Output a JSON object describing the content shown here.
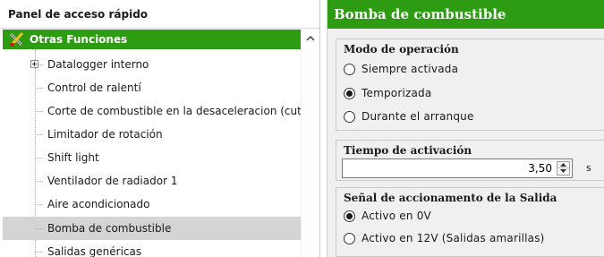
{
  "left_panel": {
    "header": "Panel de acceso rápido",
    "group": {
      "label": "Otras Funciones",
      "icon": "tools-icon"
    },
    "items": [
      {
        "label": "Datalogger interno",
        "expandable": true,
        "selected": false
      },
      {
        "label": "Control de ralentí",
        "expandable": false,
        "selected": false
      },
      {
        "label": "Corte de combustible en la desaceleracion (cutoff)",
        "expandable": false,
        "selected": false
      },
      {
        "label": "Limitador de rotación",
        "expandable": false,
        "selected": false
      },
      {
        "label": "Shift light",
        "expandable": false,
        "selected": false
      },
      {
        "label": "Ventilador de radiador 1",
        "expandable": false,
        "selected": false
      },
      {
        "label": "Aire acondicionado",
        "expandable": false,
        "selected": false
      },
      {
        "label": "Bomba de combustible",
        "expandable": false,
        "selected": true
      },
      {
        "label": "Salidas genéricas",
        "expandable": false,
        "selected": false
      }
    ]
  },
  "right_panel": {
    "title": "Bomba de combustible",
    "mode_group": {
      "title": "Modo de operación",
      "options": [
        {
          "label": "Siempre activada",
          "checked": false
        },
        {
          "label": "Temporizada",
          "checked": true
        },
        {
          "label": "Durante el arranque",
          "checked": false
        }
      ]
    },
    "activation_group": {
      "title": "Tiempo de activación",
      "value": "3,50",
      "unit": "s"
    },
    "signal_group": {
      "title": "Señal de accionamento de la Salida",
      "options": [
        {
          "label": "Activo en 0V",
          "checked": true
        },
        {
          "label": "Activo en 12V (Salidas amarillas)",
          "checked": false
        }
      ]
    }
  },
  "colors": {
    "accent_green": "#2e9c13",
    "selected_row": "#d4d4d4",
    "panel_bg": "#f0f0f0"
  }
}
